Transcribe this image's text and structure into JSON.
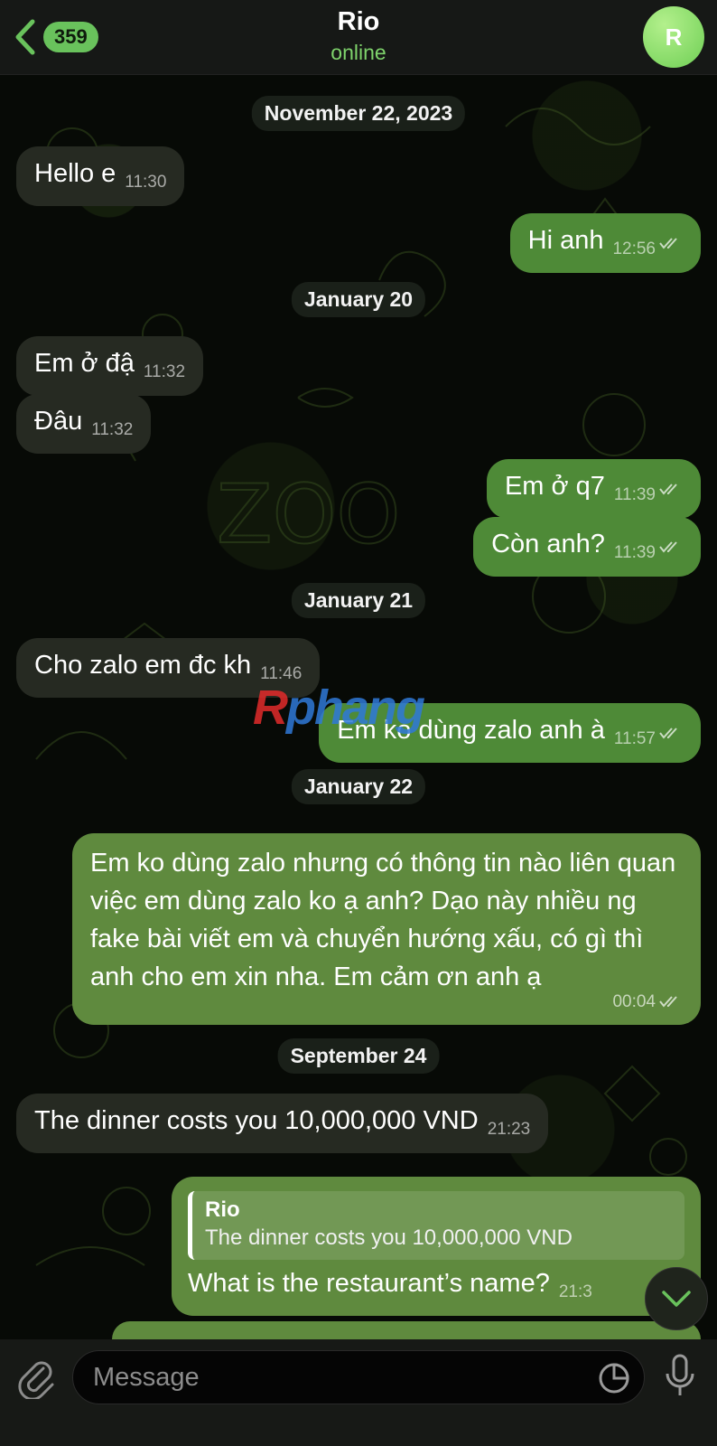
{
  "header": {
    "back_label": "Back",
    "unread_count": "359",
    "chat_name": "Rio",
    "status": "online",
    "avatar_initial": "R"
  },
  "dates": {
    "d1": "November 22, 2023",
    "d2": "January 20",
    "d3": "January 21",
    "d4": "January 22",
    "d5": "September 24"
  },
  "messages": {
    "m1": {
      "text": "Hello e",
      "time": "11:30"
    },
    "m2": {
      "text": "Hi anh",
      "time": "12:56"
    },
    "m3": {
      "text": "Em ở đậ",
      "time": "11:32"
    },
    "m4": {
      "text": "Đâu",
      "time": "11:32"
    },
    "m5": {
      "text": "Em ở q7",
      "time": "11:39"
    },
    "m6": {
      "text": "Còn anh?",
      "time": "11:39"
    },
    "m7": {
      "text": "Cho zalo em đc kh",
      "time": "11:46"
    },
    "m8": {
      "text": "Em ko dùng zalo anh à",
      "time": "11:57"
    },
    "m9": {
      "text": "Em ko dùng zalo nhưng có thông tin nào liên quan việc em dùng zalo ko ạ anh? Dạo này nhiều ng fake bài viết em và chuyển hướng xấu, có gì thì anh cho em xin nha. Em cảm ơn anh ạ",
      "time": "00:04"
    },
    "m10": {
      "text": "The dinner costs you 10,000,000 VND",
      "time": "21:23"
    },
    "m11": {
      "reply_name": "Rio",
      "reply_text": "The dinner costs you 10,000,000 VND",
      "text": "What is the restaurant’s name?",
      "time": "21:3"
    }
  },
  "watermark": {
    "part1": "R",
    "part2": "phang"
  },
  "input": {
    "placeholder": "Message"
  },
  "icons": {
    "back": "chevron-left-icon",
    "attach": "paperclip-icon",
    "sticker": "sticker-icon",
    "mic": "microphone-icon",
    "scroll": "chevron-down-icon",
    "read": "double-check-icon"
  },
  "colors": {
    "accent": "#69c25c",
    "outgoing_bubble": "#4e8a37",
    "incoming_bubble": "#262a22",
    "header_bg": "#161816"
  }
}
